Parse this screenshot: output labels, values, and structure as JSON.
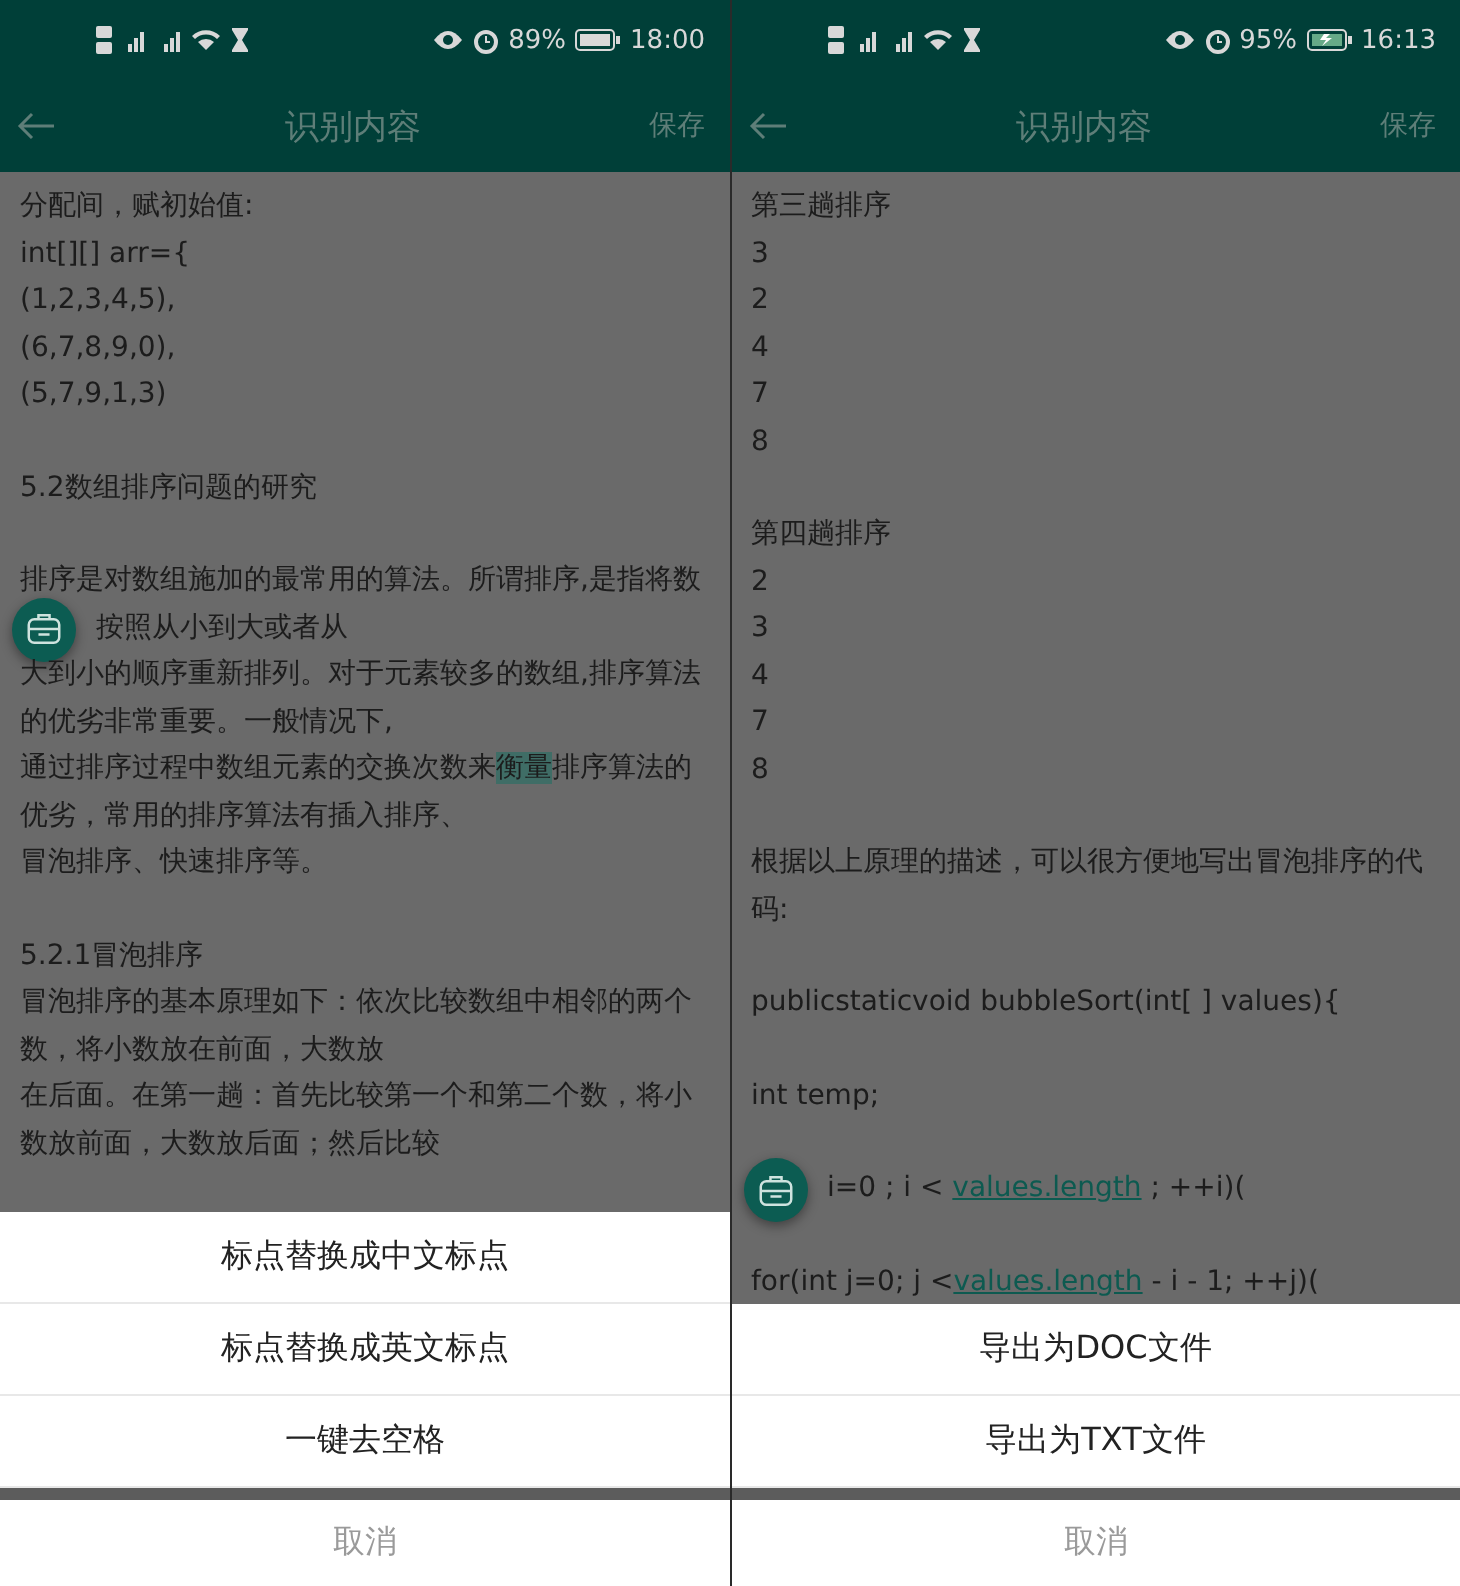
{
  "phones": [
    {
      "status_bar": {
        "battery": "89%",
        "charging": false,
        "time": "18:00"
      },
      "header": {
        "title": "识别内容",
        "action": "保存"
      },
      "content": {
        "blocks": [
          [
            "分配间，赋初始值:",
            "int[][] arr={",
            "(1,2,3,4,5),",
            "(6,7,8,9,0),",
            "(5,7,9,1,3)"
          ],
          [
            "5.2数组排序问题的研究"
          ],
          [
            "排序是对数组施加的最常用的算法。所谓排序,是指将数",
            {
              "parts": [
                {
                  "text": "按照从小到大或者从",
                  "kind": "plain"
                }
              ],
              "under_button": true
            },
            "大到小的顺序重新排列。对于元素较多的数组,排序算法",
            "的优劣非常重要。一般情况下,",
            {
              "parts": [
                {
                  "text": "通过排序过程中数组元素的交换次数来",
                  "kind": "plain"
                },
                {
                  "text": "衡量",
                  "kind": "highlight"
                },
                {
                  "text": "排序算法的",
                  "kind": "plain"
                }
              ]
            },
            "优劣，常用的排序算法有插入排序、",
            "冒泡排序、快速排序等。"
          ],
          [
            "5.2.1冒泡排序",
            "冒泡排序的基本原理如下：依次比较数组中相邻的两个",
            "数，将小数放在前面，大数放",
            "在后面。在第一趟：首先比较第一个和第二个数，将小",
            "数放前面，大数放后面；然后比较"
          ]
        ]
      },
      "sheet": {
        "options": [
          "标点替换成中文标点",
          "标点替换成英文标点",
          "一键去空格"
        ],
        "cancel": "取消"
      }
    },
    {
      "status_bar": {
        "battery": "95%",
        "charging": true,
        "time": "16:13"
      },
      "header": {
        "title": "识别内容",
        "action": "保存"
      },
      "content": {
        "blocks": [
          [
            "第三趟排序",
            "3",
            "2",
            "4",
            "7",
            "8"
          ],
          [
            "第四趟排序",
            "2",
            "3",
            "4",
            "7",
            "8"
          ],
          [
            "根据以上原理的描述，可以很方便地写出冒泡排序的代",
            "码:"
          ],
          [
            "publicstaticvoid bubbleSort(int[ ] values){"
          ],
          [
            "int temp;"
          ],
          [
            {
              "parts": [
                {
                  "text": "i=0 ; i < ",
                  "kind": "plain"
                },
                {
                  "text": "values.length",
                  "kind": "link"
                },
                {
                  "text": " ; ++i)(",
                  "kind": "plain"
                }
              ],
              "under_button": true
            }
          ],
          [
            {
              "parts": [
                {
                  "text": "for(int j=0; j <",
                  "kind": "plain"
                },
                {
                  "text": "values.length",
                  "kind": "link"
                },
                {
                  "text": " - i - 1; ++j)(",
                  "kind": "plain"
                }
              ]
            }
          ]
        ]
      },
      "sheet": {
        "options": [
          "导出为DOC文件",
          "导出为TXT文件"
        ],
        "cancel": "取消"
      }
    }
  ]
}
